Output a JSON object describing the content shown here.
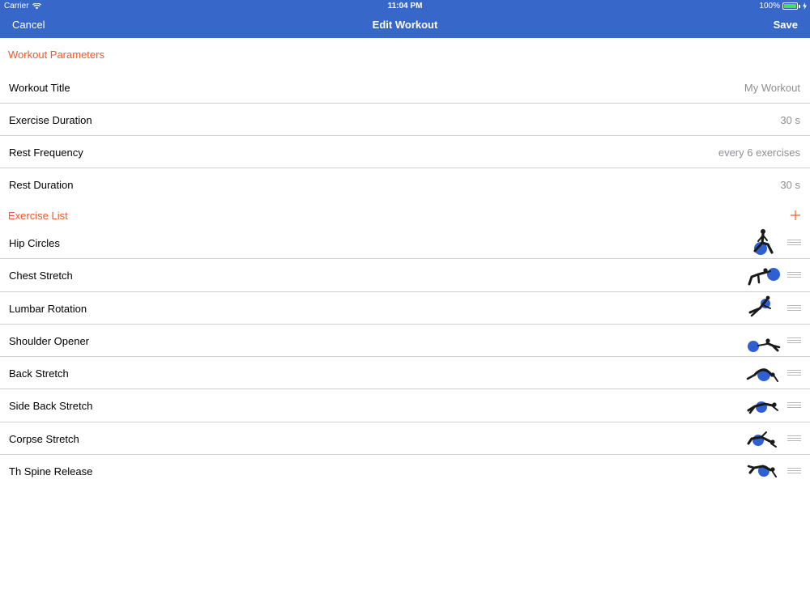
{
  "status_bar": {
    "carrier": "Carrier",
    "time": "11:04 PM",
    "battery": "100%",
    "battery_level": 1.0,
    "wifi_icon": "wifi-icon",
    "battery_icon": "battery-icon"
  },
  "nav": {
    "cancel": "Cancel",
    "title": "Edit Workout",
    "save": "Save"
  },
  "sections": {
    "parameters": "Workout Parameters",
    "exercise_list": "Exercise List",
    "add_icon": "plus-icon"
  },
  "parameters": [
    {
      "label": "Workout Title",
      "value": "My Workout"
    },
    {
      "label": "Exercise Duration",
      "value": "30 s"
    },
    {
      "label": "Rest Frequency",
      "value": "every 6 exercises"
    },
    {
      "label": "Rest Duration",
      "value": "30 s"
    }
  ],
  "exercises": [
    {
      "label": "Hip Circles",
      "pose": "sitting"
    },
    {
      "label": "Chest Stretch",
      "pose": "kneeling-forward"
    },
    {
      "label": "Lumbar Rotation",
      "pose": "lying-twist"
    },
    {
      "label": "Shoulder Opener",
      "pose": "kneeling-reach"
    },
    {
      "label": "Back Stretch",
      "pose": "arched-back"
    },
    {
      "label": "Side Back Stretch",
      "pose": "side-lying"
    },
    {
      "label": "Corpse Stretch",
      "pose": "supine"
    },
    {
      "label": "Th Spine Release",
      "pose": "supine-arms"
    }
  ],
  "colors": {
    "brand": "#3767c9",
    "accent": "#f0582a",
    "ball": "#2f5fd0",
    "secondary_text": "#8e8e93",
    "separator": "#cfcfcf"
  }
}
